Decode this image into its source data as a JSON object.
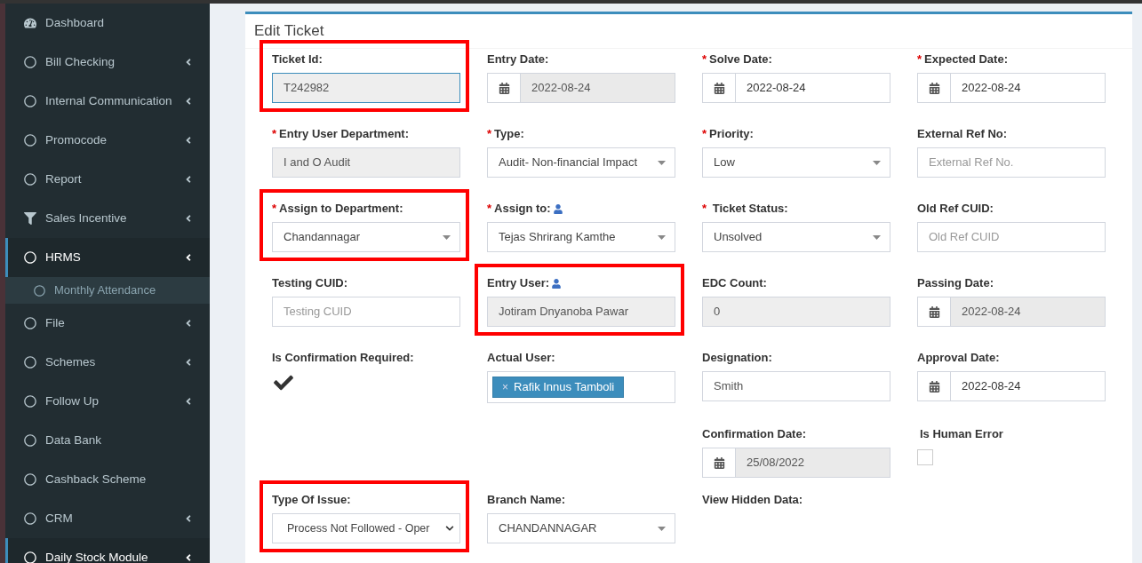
{
  "sidebar": {
    "items": [
      {
        "label": "Dashboard",
        "expandable": false,
        "selected": false
      },
      {
        "label": "Bill Checking",
        "expandable": true,
        "selected": false
      },
      {
        "label": "Internal Communication",
        "expandable": true,
        "selected": false
      },
      {
        "label": "Promocode",
        "expandable": true,
        "selected": false
      },
      {
        "label": "Report",
        "expandable": true,
        "selected": false
      },
      {
        "label": "Sales Incentive",
        "expandable": true,
        "selected": false
      },
      {
        "label": "HRMS",
        "expandable": true,
        "selected": true,
        "children": [
          {
            "label": "Monthly Attendance",
            "selected": false
          }
        ]
      },
      {
        "label": "File",
        "expandable": true,
        "selected": false
      },
      {
        "label": "Schemes",
        "expandable": true,
        "selected": false
      },
      {
        "label": "Follow Up",
        "expandable": true,
        "selected": false
      },
      {
        "label": "Data Bank",
        "expandable": false,
        "selected": false
      },
      {
        "label": "Cashback Scheme",
        "expandable": false,
        "selected": false
      },
      {
        "label": "CRM",
        "expandable": true,
        "selected": false
      },
      {
        "label": "Daily Stock Module",
        "expandable": true,
        "selected": true
      }
    ]
  },
  "form": {
    "title": "Edit Ticket",
    "rows": [
      [
        {
          "label": "Ticket Id:",
          "kind": "input",
          "value": "T242982",
          "readonly": true,
          "focused": true,
          "highlighted": true
        },
        {
          "label": "Entry Date:",
          "kind": "date",
          "value": "2022-08-24",
          "readonly": true,
          "highlighted": false
        },
        {
          "mark": "*",
          "label": "Solve Date:",
          "kind": "date",
          "value": "2022-08-24",
          "readonly": false,
          "highlighted": false
        },
        {
          "mark": "*",
          "label": "Expected Date:",
          "kind": "date",
          "value": "2022-08-24",
          "readonly": false,
          "highlighted": false
        }
      ],
      [
        {
          "mark": "*",
          "label": "Entry User Department:",
          "kind": "input",
          "value": "I and O Audit",
          "readonly": true,
          "focused": false,
          "highlighted": false
        },
        {
          "mark": "*",
          "label": "Type:",
          "kind": "select",
          "value": "Audit- Non-financial Impact",
          "highlighted": false
        },
        {
          "mark": "*",
          "label": "Priority:",
          "kind": "select",
          "value": "Low",
          "highlighted": false
        },
        {
          "label": "External Ref No:",
          "kind": "input",
          "placeholder": "External Ref No.",
          "readonly": false,
          "focused": false,
          "highlighted": false
        }
      ],
      [
        {
          "mark": "*",
          "label": "Assign to Department:",
          "kind": "select",
          "value": "Chandannagar",
          "highlighted": true
        },
        {
          "mark": "*",
          "label": "Assign to:",
          "user_icon": true,
          "kind": "select",
          "value": "Tejas Shrirang Kamthe",
          "highlighted": false
        },
        {
          "mark": "* ",
          "label": "Ticket Status:",
          "kind": "select",
          "value": "Unsolved",
          "highlighted": false
        },
        {
          "label": "Old Ref CUID:",
          "kind": "input",
          "placeholder": "Old Ref CUID",
          "readonly": false,
          "focused": false,
          "highlighted": false
        }
      ],
      [
        {
          "label": "Testing CUID:",
          "kind": "input",
          "placeholder": "Testing CUID",
          "readonly": false,
          "focused": false,
          "highlighted": false
        },
        {
          "label": "Entry User:",
          "user_icon": true,
          "kind": "input",
          "value": "Jotiram Dnyanoba Pawar",
          "readonly": true,
          "focused": false,
          "highlighted": true
        },
        {
          "label": "EDC Count:",
          "kind": "input",
          "value": "0",
          "readonly": true,
          "focused": false,
          "highlighted": false
        },
        {
          "label": "Passing Date:",
          "kind": "date",
          "value": "2022-08-24",
          "readonly": true,
          "highlighted": false
        }
      ],
      [
        {
          "label": "Is Confirmation Required:",
          "kind": "check",
          "checked": true,
          "highlighted": false
        },
        {
          "label": "Actual User:",
          "kind": "tags",
          "tags": [
            {
              "label": "Rafik Innus Tamboli",
              "remove": "×"
            }
          ],
          "highlighted": false
        },
        {
          "label": "Designation:",
          "kind": "input",
          "value": "Smith",
          "readonly": false,
          "focused": false,
          "highlighted": false
        },
        {
          "label": "Approval Date:",
          "kind": "date",
          "value": "2022-08-24",
          "readonly": false,
          "highlighted": false
        }
      ],
      [
        null,
        null,
        {
          "label": "Confirmation Date:",
          "kind": "date",
          "value": "25/08/2022",
          "readonly": true,
          "highlighted": false
        },
        {
          "label": "Is Human Error",
          "kind": "checkbox",
          "checked": false,
          "highlighted": false
        }
      ],
      [
        {
          "label": "Type Of Issue:",
          "kind": "native_select",
          "value": "Process Not Followed - Oper",
          "highlighted": true
        },
        {
          "label": "Branch Name:",
          "kind": "select",
          "value": "CHANDANNAGAR",
          "highlighted": false
        },
        {
          "label": "View Hidden Data:",
          "kind": "label",
          "highlighted": false
        },
        null
      ]
    ]
  }
}
